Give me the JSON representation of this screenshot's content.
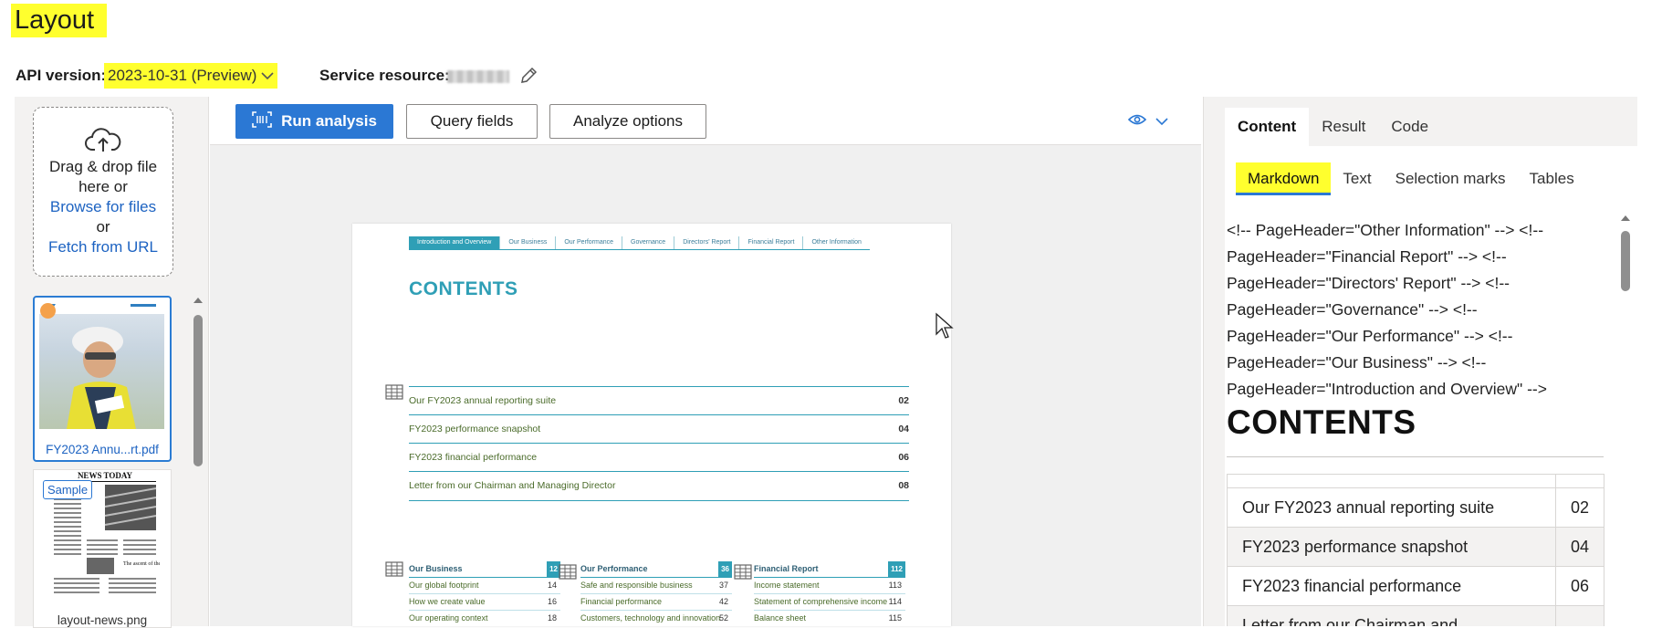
{
  "title": "Layout",
  "api": {
    "label": "API version:",
    "value": "2023-10-31 (Preview)"
  },
  "service": {
    "label": "Service resource:"
  },
  "upload": {
    "line1": "Drag & drop file",
    "line2": "here or",
    "browse": "Browse for files",
    "or": "or",
    "fetch": "Fetch from URL"
  },
  "files": [
    {
      "name": "FY2023 Annu...rt.pdf"
    },
    {
      "name": "layout-news.png",
      "badge": "Sample"
    }
  ],
  "toolbar": {
    "run": "Run analysis",
    "query": "Query fields",
    "analyze": "Analyze options"
  },
  "document": {
    "nav": [
      "Introduction and Overview",
      "Our Business",
      "Our Performance",
      "Governance",
      "Directors' Report",
      "Financial Report",
      "Other Information"
    ],
    "heading": "CONTENTS",
    "rows": [
      {
        "label": "Our FY2023 annual reporting suite",
        "num": "02"
      },
      {
        "label": "FY2023 performance snapshot",
        "num": "04"
      },
      {
        "label": "FY2023 financial performance",
        "num": "06"
      },
      {
        "label": "Letter from our Chairman and Managing Director",
        "num": "08"
      }
    ],
    "columns": [
      {
        "title": "Our Business",
        "badge": "12",
        "items": [
          {
            "label": "Our global footprint",
            "num": "14"
          },
          {
            "label": "How we create value",
            "num": "16"
          },
          {
            "label": "Our operating context",
            "num": "18"
          }
        ]
      },
      {
        "title": "Our Performance",
        "badge": "36",
        "items": [
          {
            "label": "Safe and responsible business",
            "num": "37"
          },
          {
            "label": "Financial performance",
            "num": "42"
          },
          {
            "label": "Customers, technology and innovation",
            "num": "52"
          }
        ]
      },
      {
        "title": "Financial Report",
        "badge": "112",
        "items": [
          {
            "label": "Income statement",
            "num": "113"
          },
          {
            "label": "Statement of comprehensive income",
            "num": "114"
          },
          {
            "label": "Balance sheet",
            "num": "115"
          }
        ]
      }
    ]
  },
  "results": {
    "tabs": [
      "Content",
      "Result",
      "Code"
    ],
    "subtabs": [
      "Markdown",
      "Text",
      "Selection marks",
      "Tables"
    ],
    "markdown_lines": [
      "<!-- PageHeader=\"Other Information\" --> <!--",
      "PageHeader=\"Financial Report\" --> <!--",
      "PageHeader=\"Directors' Report\" --> <!--",
      "PageHeader=\"Governance\" --> <!--",
      "PageHeader=\"Our Performance\" --> <!--",
      "PageHeader=\"Our Business\" --> <!--",
      "PageHeader=\"Introduction and Overview\" -->"
    ],
    "heading": "CONTENTS",
    "table": [
      [
        "Our FY2023 annual reporting suite",
        "02"
      ],
      [
        "FY2023 performance snapshot",
        "04"
      ],
      [
        "FY2023 financial performance",
        "06"
      ],
      [
        "Letter from our Chairman and",
        ""
      ]
    ]
  },
  "colors": {
    "accent": "#2b78d4",
    "highlight": "#ffff2e",
    "doc_teal": "#2f9fb6"
  }
}
